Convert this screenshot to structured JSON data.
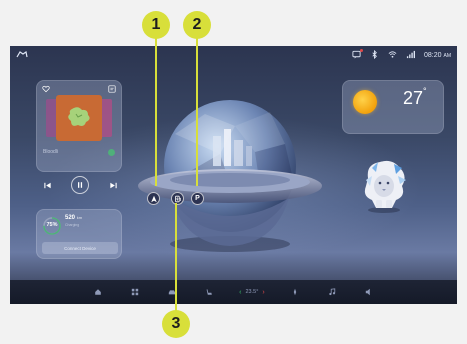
{
  "status_bar": {
    "time": "08:20",
    "ampm": "AM",
    "icons": [
      "message-icon",
      "bluetooth-icon",
      "wifi-icon",
      "signal-icon"
    ]
  },
  "music": {
    "track_title": "Bloodli",
    "controls": [
      "previous-icon",
      "pause-icon",
      "next-icon"
    ]
  },
  "charging": {
    "soc": "75%",
    "range": "520",
    "range_unit": "km",
    "status": "Charging",
    "connect_label": "Connect Device"
  },
  "weather": {
    "temperature": "27",
    "unit": "°"
  },
  "map_buttons": {
    "nav_icon": "navigation-arrow-icon",
    "charge_icon": "charging-station-icon",
    "parking_label": "P"
  },
  "dock": {
    "climate_temp": "23.5°",
    "items": [
      "home-icon",
      "apps-icon",
      "car-icon",
      "seat-heat-icon",
      "fan-icon",
      "music-icon",
      "volume-icon"
    ]
  },
  "callouts": [
    "1",
    "2",
    "3"
  ],
  "colors": {
    "callout": "#d8df3a",
    "screen_bg": "#2c3550",
    "dock_bg": "#151a28",
    "charge_green": "#4fb07a",
    "sun": "#f2a10b"
  }
}
